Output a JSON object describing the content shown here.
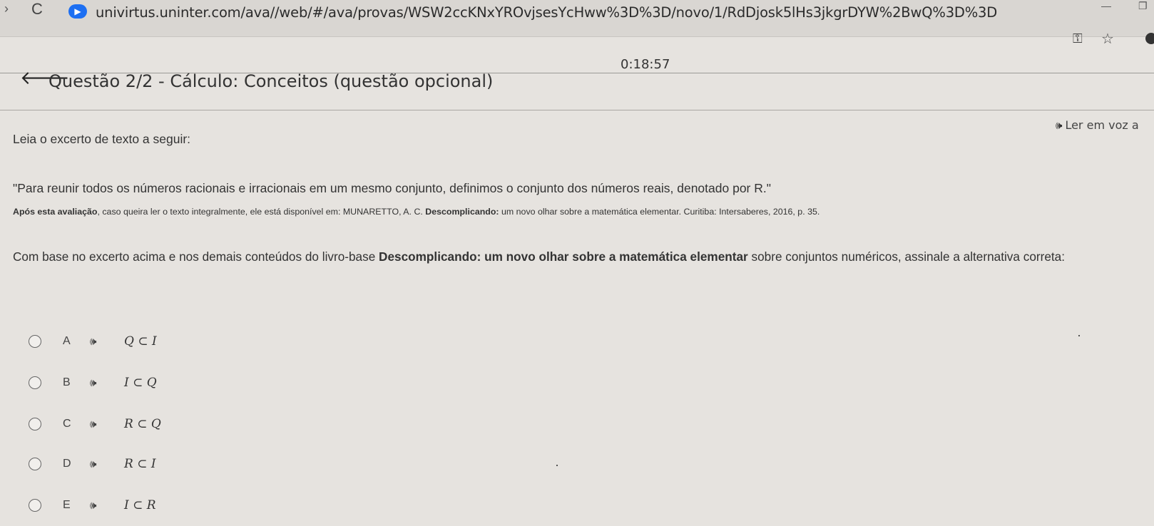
{
  "browser": {
    "nav_forward_icon": "›",
    "reload_icon": "C",
    "url": "univirtus.uninter.com/ava//web/#/ava/provas/WSW2ccKNxYROvjsesYcHww%3D%3D/novo/1/RdDjosk5lHs3jkgrDYW%2BwQ%3D%3D",
    "key_icon": "⚿",
    "star_icon": "☆",
    "minimize_icon": "—",
    "restore_icon": "❐"
  },
  "header": {
    "timer": "0:18:57",
    "title": "Questão 2/2 - Cálculo: Conceitos (questão opcional)",
    "read_aloud": "Ler em voz a"
  },
  "question": {
    "intro": "Leia o excerto de texto a seguir:",
    "quote": "\"Para reunir todos os números racionais e irracionais em um mesmo conjunto, definimos o conjunto dos números reais, denotado por R.\"",
    "citation_bold": "Após esta avaliação",
    "citation_mid": ", caso queira ler o texto integralmente, ele está disponível em: MUNARETTO, A. C. ",
    "citation_book_bold": "Descomplicando:",
    "citation_rest": " um novo olhar sobre a matemática elementar. Curitiba: Intersaberes, 2016, p. 35.",
    "prompt_start": "Com base no excerto acima e nos demais conteúdos do livro-base ",
    "prompt_book": "Descomplicando: um novo olhar sobre a matemática elementar",
    "prompt_end": " sobre conjuntos numéricos, assinale a alternativa correta:"
  },
  "options": [
    {
      "letter": "A",
      "formula": "Q ⊂ I"
    },
    {
      "letter": "B",
      "formula": "I ⊂ Q"
    },
    {
      "letter": "C",
      "formula": "R ⊂ Q"
    },
    {
      "letter": "D",
      "formula": "R ⊂ I"
    },
    {
      "letter": "E",
      "formula": "I ⊂ R"
    }
  ],
  "speaker_icon": "🕪"
}
